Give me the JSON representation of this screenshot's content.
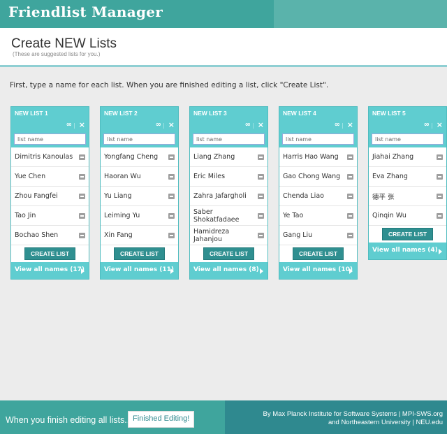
{
  "app": {
    "title": "Friendlist Manager"
  },
  "header": {
    "title": "Create NEW Lists",
    "subtitle": "(These are suggested lists for you.)"
  },
  "instructions": "First, type a name for each list. When you are finished editing a list, click \"Create List\".",
  "icons": {
    "merge": "∞",
    "separator": "|",
    "close": "×"
  },
  "lists": [
    {
      "title": "NEW LIST 1",
      "name_placeholder": "list name",
      "members": [
        "Dimitris Kanoulas",
        "Yue Chen",
        "Zhou Fangfei",
        "Tao Jin",
        "Bochao Shen"
      ],
      "create_label": "CREATE LIST",
      "view_all": "View all names (17)"
    },
    {
      "title": "NEW LIST 2",
      "name_placeholder": "list name",
      "members": [
        "Yongfang Cheng",
        "Haoran Wu",
        "Yu Liang",
        "Leiming Yu",
        "Xin Fang"
      ],
      "create_label": "CREATE LIST",
      "view_all": "View all names (11)"
    },
    {
      "title": "NEW LIST 3",
      "name_placeholder": "list name",
      "members": [
        "Liang Zhang",
        "Eric Miles",
        "Zahra Jafargholi",
        "Saber Shokatfadaee",
        "Hamidreza Jahanjou"
      ],
      "create_label": "CREATE LIST",
      "view_all": "View all names (8)"
    },
    {
      "title": "NEW LIST 4",
      "name_placeholder": "list name",
      "members": [
        "Harris Hao Wang",
        "Gao Chong Wang",
        "Chenda Liao",
        "Ye Tao",
        "Gang Liu"
      ],
      "create_label": "CREATE LIST",
      "view_all": "View all names (10)"
    },
    {
      "title": "NEW LIST 5",
      "name_placeholder": "list name",
      "members": [
        "Jiahai Zhang",
        "Eva Zhang",
        "德平 张",
        "Qinqin Wu"
      ],
      "create_label": "CREATE LIST",
      "view_all": "View all names (4)"
    }
  ],
  "footer": {
    "prompt": "When you finish editing all lists...",
    "finish_button": "Finished Editing!",
    "credit_line1": "By Max Planck Institute for Software Systems | MPI-SWS.org",
    "credit_line2": "and Northeastern University | NEU.edu"
  }
}
